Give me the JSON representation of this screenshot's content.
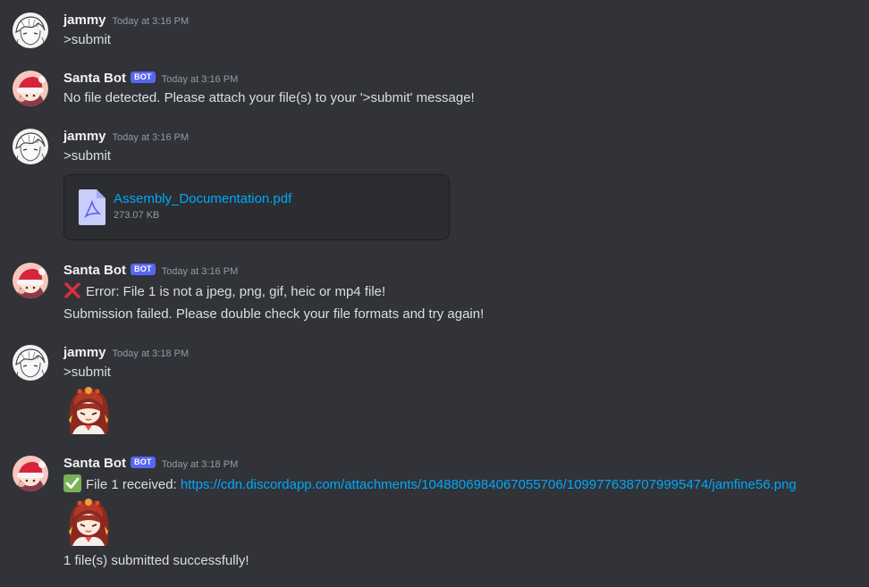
{
  "messages": [
    {
      "author": "jammy",
      "timestamp": "Today at 3:16 PM",
      "text": ">submit"
    },
    {
      "author": "Santa Bot",
      "badge": "BOT",
      "timestamp": "Today at 3:16 PM",
      "text": "No file detected. Please attach your file(s) to your '>submit' message!"
    },
    {
      "author": "jammy",
      "timestamp": "Today at 3:16 PM",
      "text": ">submit",
      "attachment": {
        "name": "Assembly_Documentation.pdf",
        "size": "273.07 KB",
        "icon": "pdf-file-icon"
      }
    },
    {
      "author": "Santa Bot",
      "badge": "BOT",
      "timestamp": "Today at 3:16 PM",
      "line1": "Error: File 1 is not a jpeg, png, gif, heic or mp4 file!",
      "line1_icon": "red-x-icon",
      "line2": "Submission failed. Please double check your file formats and try again!"
    },
    {
      "author": "jammy",
      "timestamp": "Today at 3:18 PM",
      "text": ">submit",
      "image": "anime-girl-sticker"
    },
    {
      "author": "Santa Bot",
      "badge": "BOT",
      "timestamp": "Today at 3:18 PM",
      "line1_prefix": "File 1 received: ",
      "line1_icon": "green-check-icon",
      "link": "https://cdn.discordapp.com/attachments/1048806984067055706/1099776387079995474/jamfine56.png",
      "image": "anime-girl-sticker",
      "footer": "1 file(s) submitted successfully!"
    }
  ],
  "colors": {
    "background": "#313338",
    "link": "#00a8fc",
    "bot_badge": "#5865f2"
  }
}
